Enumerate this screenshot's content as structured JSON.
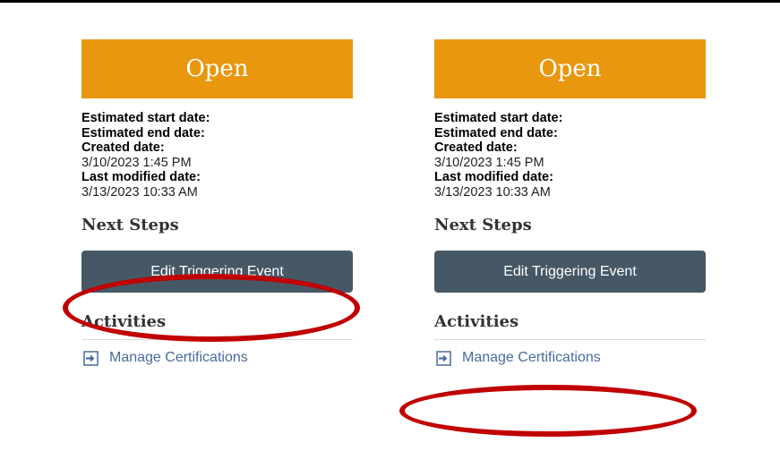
{
  "colors": {
    "banner": "#e8970f",
    "button": "#465866",
    "link": "#4a6b9a",
    "highlight": "#c00000"
  },
  "panels": [
    {
      "status": "Open",
      "meta": [
        {
          "label": "Estimated start date:",
          "value": ""
        },
        {
          "label": "Estimated end date:",
          "value": ""
        },
        {
          "label": "Created date:",
          "value": "3/10/2023 1:45 PM"
        },
        {
          "label": "Last modified date:",
          "value": "3/13/2023 10:33 AM"
        }
      ],
      "next_steps_heading": "Next Steps",
      "edit_button_label": "Edit Triggering Event",
      "activities_heading": "Activities",
      "activity_link_label": "Manage Certifications",
      "activity_icon": "arrow-into-box-icon"
    },
    {
      "status": "Open",
      "meta": [
        {
          "label": "Estimated start date:",
          "value": ""
        },
        {
          "label": "Estimated end date:",
          "value": ""
        },
        {
          "label": "Created date:",
          "value": "3/10/2023 1:45 PM"
        },
        {
          "label": "Last modified date:",
          "value": "3/13/2023 10:33 AM"
        }
      ],
      "next_steps_heading": "Next Steps",
      "edit_button_label": "Edit Triggering Event",
      "activities_heading": "Activities",
      "activity_link_label": "Manage Certifications",
      "activity_icon": "arrow-into-box-icon"
    }
  ]
}
